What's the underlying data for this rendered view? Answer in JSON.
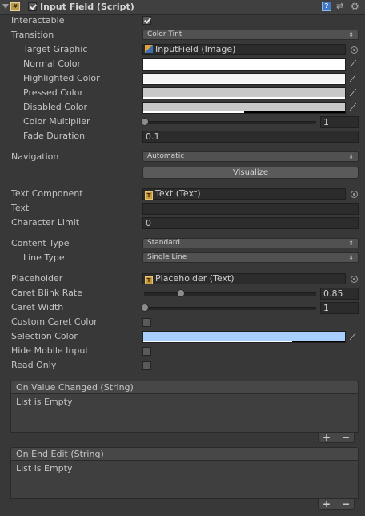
{
  "header": {
    "title": "Input Field (Script)",
    "enabled": true,
    "icons": [
      "script-icon",
      "help-icon",
      "preset-icon",
      "gear-icon"
    ]
  },
  "fields": {
    "interactable": {
      "label": "Interactable",
      "checked": true
    },
    "transition": {
      "label": "Transition",
      "value": "Color Tint"
    },
    "target_graphic": {
      "label": "Target Graphic",
      "value": "InputField (Image)"
    },
    "normal_color": {
      "label": "Normal Color",
      "color": "#ffffff"
    },
    "highlighted_color": {
      "label": "Highlighted Color",
      "color": "#f5f5f5"
    },
    "pressed_color": {
      "label": "Pressed Color",
      "color": "#c8c8c8"
    },
    "disabled_color": {
      "label": "Disabled Color",
      "color": "#c8c8c8"
    },
    "color_multiplier": {
      "label": "Color Multiplier",
      "value": "1"
    },
    "fade_duration": {
      "label": "Fade Duration",
      "value": "0.1"
    },
    "navigation": {
      "label": "Navigation",
      "value": "Automatic"
    },
    "visualize": {
      "label": "Visualize"
    },
    "text_component": {
      "label": "Text Component",
      "value": "Text (Text)"
    },
    "text": {
      "label": "Text",
      "value": ""
    },
    "character_limit": {
      "label": "Character Limit",
      "value": "0"
    },
    "content_type": {
      "label": "Content Type",
      "value": "Standard"
    },
    "line_type": {
      "label": "Line Type",
      "value": "Single Line"
    },
    "placeholder": {
      "label": "Placeholder",
      "value": "Placeholder (Text)"
    },
    "caret_blink_rate": {
      "label": "Caret Blink Rate",
      "value": "0.85"
    },
    "caret_width": {
      "label": "Caret Width",
      "value": "1"
    },
    "custom_caret_color": {
      "label": "Custom Caret Color",
      "checked": false
    },
    "selection_color": {
      "label": "Selection Color",
      "color": "#a8cefe"
    },
    "hide_mobile_input": {
      "label": "Hide Mobile Input",
      "checked": false
    },
    "read_only": {
      "label": "Read Only",
      "checked": false
    }
  },
  "events": [
    {
      "title": "On Value Changed (String)",
      "empty_text": "List is Empty"
    },
    {
      "title": "On End Edit (String)",
      "empty_text": "List is Empty"
    }
  ],
  "list_buttons": {
    "add": "+",
    "remove": "−"
  },
  "colors": {
    "panel": "#383838",
    "accent_selection": "#a8cefe"
  }
}
